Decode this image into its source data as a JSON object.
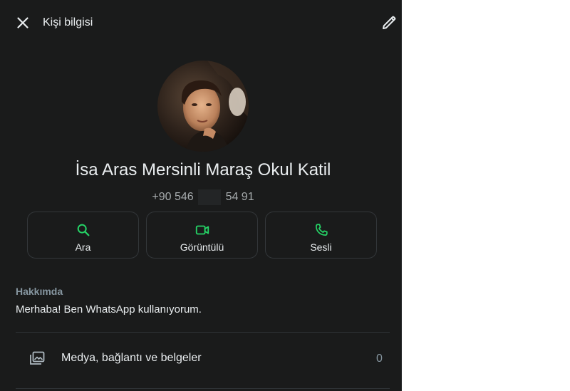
{
  "header": {
    "title": "Kişi bilgisi",
    "close_icon": "close-icon",
    "edit_icon": "pencil-icon"
  },
  "contact": {
    "name": "İsa Aras Mersinli Maraş Okul Katil",
    "phone_prefix": "+90 546",
    "phone_suffix": "54 91"
  },
  "actions": [
    {
      "label": "Ara",
      "icon": "search-icon"
    },
    {
      "label": "Görüntülü",
      "icon": "video-call-icon"
    },
    {
      "label": "Sesli",
      "icon": "phone-icon"
    }
  ],
  "about": {
    "heading": "Hakkımda",
    "text": "Merhaba! Ben WhatsApp kullanıyorum."
  },
  "media": {
    "label": "Medya, bağlantı ve belgeler",
    "count": "0",
    "icon": "media-gallery-icon"
  },
  "colors": {
    "background": "#1a1b1b",
    "accent": "#25d366",
    "text_primary": "#e9edef",
    "text_secondary": "#8696a0"
  }
}
